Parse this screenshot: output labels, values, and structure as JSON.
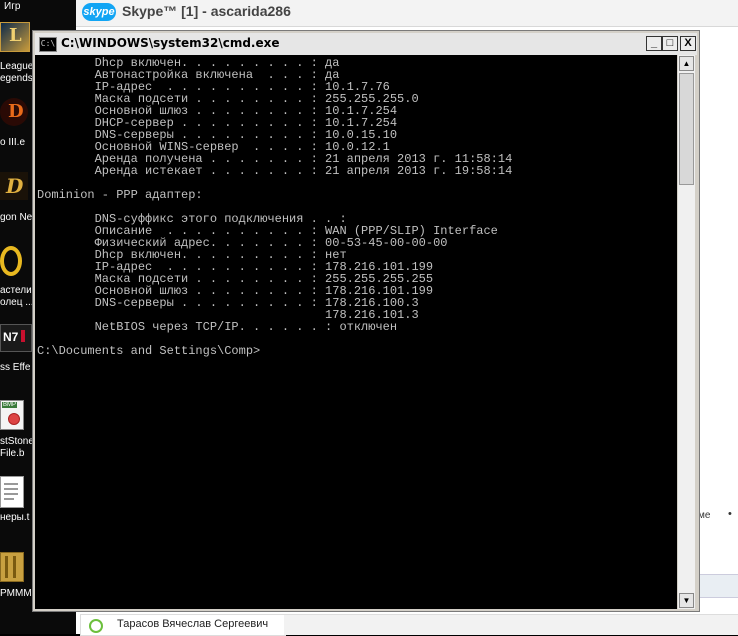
{
  "desktop": {
    "top_label": "Игр",
    "icons": [
      {
        "name": "league-of-legends-icon",
        "lines": [
          "League",
          "egends"
        ]
      },
      {
        "name": "diablo-iii-icon",
        "lines": [
          "o III.e"
        ]
      },
      {
        "name": "dragon-nest-icon",
        "lines": [
          "gon Ne"
        ]
      },
      {
        "name": "lotr-ring-icon",
        "lines": [
          "астели",
          "олец ..."
        ]
      },
      {
        "name": "mass-effect-icon",
        "lines": [
          "ss Effe"
        ]
      },
      {
        "name": "bmp-file-icon",
        "lines": [
          "stStone",
          "File.b"
        ]
      },
      {
        "name": "text-document-icon",
        "lines": [
          "неры.t"
        ]
      },
      {
        "name": "rpmmm-icon",
        "lines": [
          "PMMM"
        ]
      }
    ]
  },
  "skype": {
    "logo": "skype",
    "title": "Skype™ [1] - ascarida286",
    "contact_name": "Тарасов Вячеслав Сергеевич",
    "side_text": "ме",
    "side_dot": "•"
  },
  "cmd": {
    "title_icon": "C:\\",
    "title": "C:\\WINDOWS\\system32\\cmd.exe",
    "buttons": {
      "minimize": "_",
      "maximize": "□",
      "close": "X"
    },
    "lines": [
      "        Dhcp включен. . . . . . . . . : да",
      "        Автонастройка включена  . . . : да",
      "        IP-адрес  . . . . . . . . . . : 10.1.7.76",
      "        Маска подсети . . . . . . . . : 255.255.255.0",
      "        Основной шлюз . . . . . . . . : 10.1.7.254",
      "        DHCP-сервер . . . . . . . . . : 10.1.7.254",
      "        DNS-серверы . . . . . . . . . : 10.0.15.10",
      "        Основной WINS-сервер  . . . . : 10.0.12.1",
      "        Аренда получена . . . . . . . : 21 апреля 2013 г. 11:58:14",
      "        Аренда истекает . . . . . . . : 21 апреля 2013 г. 19:58:14",
      "",
      "Dominion - PPP адаптер:",
      "",
      "        DNS-суффикс этого подключения . . :",
      "        Описание  . . . . . . . . . . : WAN (PPP/SLIP) Interface",
      "        Физический адрес. . . . . . . : 00-53-45-00-00-00",
      "        Dhcp включен. . . . . . . . . : нет",
      "        IP-адрес  . . . . . . . . . . : 178.216.101.199",
      "        Маска подсети . . . . . . . . : 255.255.255.255",
      "        Основной шлюз . . . . . . . . : 178.216.101.199",
      "        DNS-серверы . . . . . . . . . : 178.216.100.3",
      "                                        178.216.101.3",
      "        NetBIOS через TCP/IP. . . . . . : отключен",
      "",
      "C:\\Documents and Settings\\Comp>"
    ],
    "scroll_up": "▲",
    "scroll_down": "▼"
  },
  "colors": {
    "console_bg": "#000000",
    "console_text": "#c0c0c0",
    "skype_blue": "#12a5f4"
  }
}
